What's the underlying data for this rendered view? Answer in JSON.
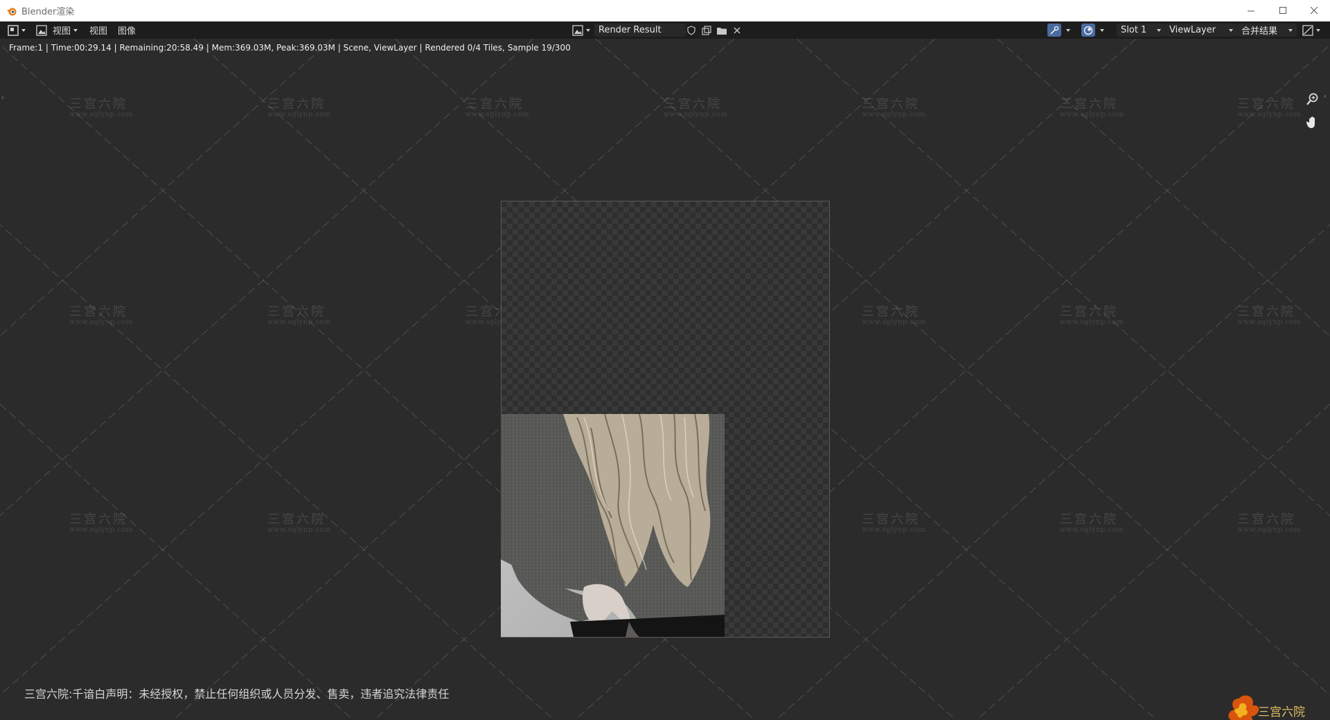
{
  "window": {
    "title": "Blender渲染",
    "controls": {
      "minimize": "–",
      "maximize": "☐",
      "close": "✕"
    }
  },
  "header": {
    "editor_type_icon": "image-editor-icon",
    "view_mode_icon": "image-icon",
    "menu_view_dropdown": "视图",
    "menu_view": "视图",
    "menu_image": "图像",
    "image_browse_icon": "image-browse-icon",
    "image_name": "Render Result",
    "slot": "Slot 1",
    "view_layer": "ViewLayer",
    "render_pass": "合并结果",
    "accent_color": "#4a6aa0"
  },
  "status": {
    "line": "Frame:1 | Time:00:29.14 | Remaining:20:58.49 | Mem:369.03M, Peak:369.03M | Scene, ViewLayer | Rendered 0/4 Tiles, Sample 19/300"
  },
  "render": {
    "tiles_total": 4,
    "tiles_done": 0,
    "sample_current": 19,
    "sample_total": 300
  },
  "watermark": {
    "text": "三宫六院",
    "url": "www.sglynp.com"
  },
  "notice": "三宫六院:千谙白声明：未经授权，禁止任何组织或人员分发、售卖，违者追究法律责任"
}
